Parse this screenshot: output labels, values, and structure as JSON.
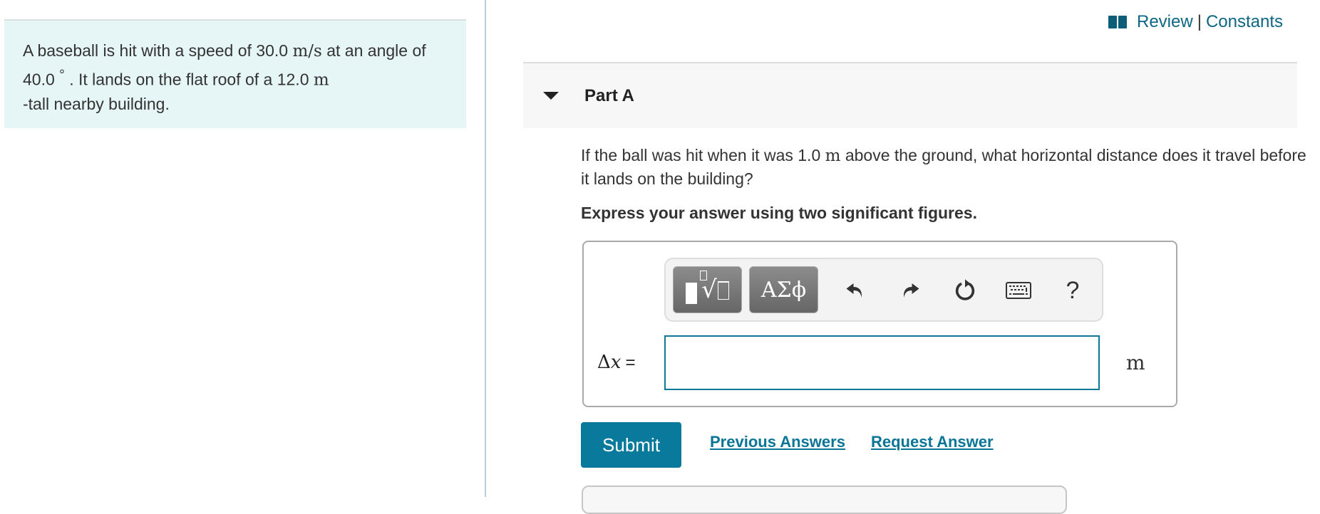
{
  "intro": {
    "text_parts": {
      "p1": "A baseball is hit with a speed of 30.0 ",
      "u1": "m/s",
      "p2": " at an angle of 40.0 ",
      "deg": "°",
      "p3": " . It lands on the flat roof of a 12.0 ",
      "u2": "m",
      "p4": " -tall nearby building."
    }
  },
  "header": {
    "icon": "book-icon",
    "review_label": "Review",
    "separator": "|",
    "constants_label": "Constants"
  },
  "part": {
    "toggle_icon": "triangle-down-icon",
    "title": "Part A",
    "question": {
      "p1": "If the ball was hit when it was 1.0 ",
      "unit": "m",
      "p2": " above the ground, what horizontal distance does it travel before it lands on the building?"
    },
    "instruction": "Express your answer using two significant figures."
  },
  "toolbar": {
    "templates_icon": "templates-icon",
    "greek_label": "ΑΣϕ",
    "undo_icon": "undo-icon",
    "redo_icon": "redo-icon",
    "reset_icon": "reset-icon",
    "keyboard_icon": "keyboard-icon",
    "help_label": "?"
  },
  "answer": {
    "label_symbol": "Δ",
    "label_var": "x",
    "label_eq": "=",
    "value": "",
    "placeholder": "",
    "unit": "m"
  },
  "actions": {
    "submit_label": "Submit",
    "previous_answers_label": "Previous Answers",
    "request_answer_label": "Request Answer"
  },
  "colors": {
    "accent": "#0a7a9c",
    "link": "#0d6683",
    "intro_bg": "#e6f5f6"
  }
}
